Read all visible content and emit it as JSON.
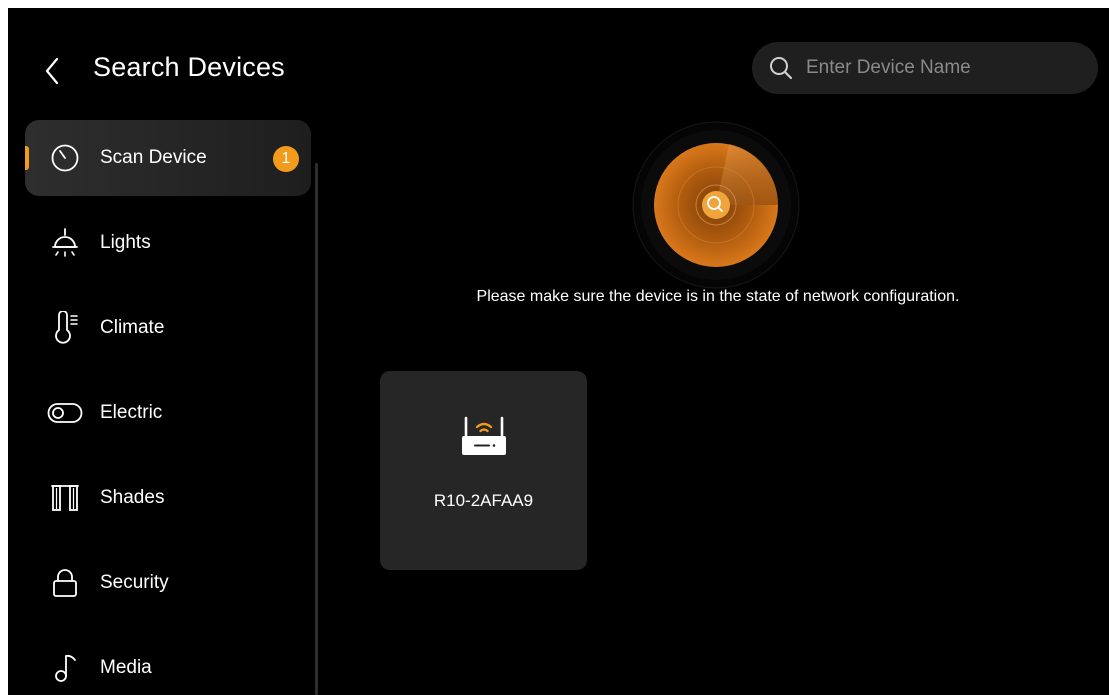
{
  "header": {
    "title": "Search Devices",
    "back_icon": "chevron-left-icon"
  },
  "search": {
    "placeholder": "Enter Device Name",
    "value": "",
    "icon": "search-icon"
  },
  "sidebar": {
    "items": [
      {
        "label": "Scan Device",
        "icon": "timer-icon",
        "active": true,
        "badge": "1"
      },
      {
        "label": "Lights",
        "icon": "ceiling-lamp-icon",
        "active": false
      },
      {
        "label": "Climate",
        "icon": "thermometer-icon",
        "active": false
      },
      {
        "label": "Electric",
        "icon": "toggle-switch-icon",
        "active": false
      },
      {
        "label": "Shades",
        "icon": "curtain-icon",
        "active": false
      },
      {
        "label": "Security",
        "icon": "lock-icon",
        "active": false
      },
      {
        "label": "Media",
        "icon": "music-note-icon",
        "active": false
      }
    ]
  },
  "main": {
    "radar_icon": "radar-search-icon",
    "hint": "Please make sure the device is in the state of network configuration.",
    "devices": [
      {
        "name": "R10-2AFAA9",
        "icon": "router-wifi-icon"
      }
    ]
  },
  "colors": {
    "background": "#000000",
    "accent": "#f39b1c",
    "card": "#262626",
    "search_bg": "#1f1f1f",
    "text": "#ffffff",
    "placeholder": "#8a8a8a"
  }
}
